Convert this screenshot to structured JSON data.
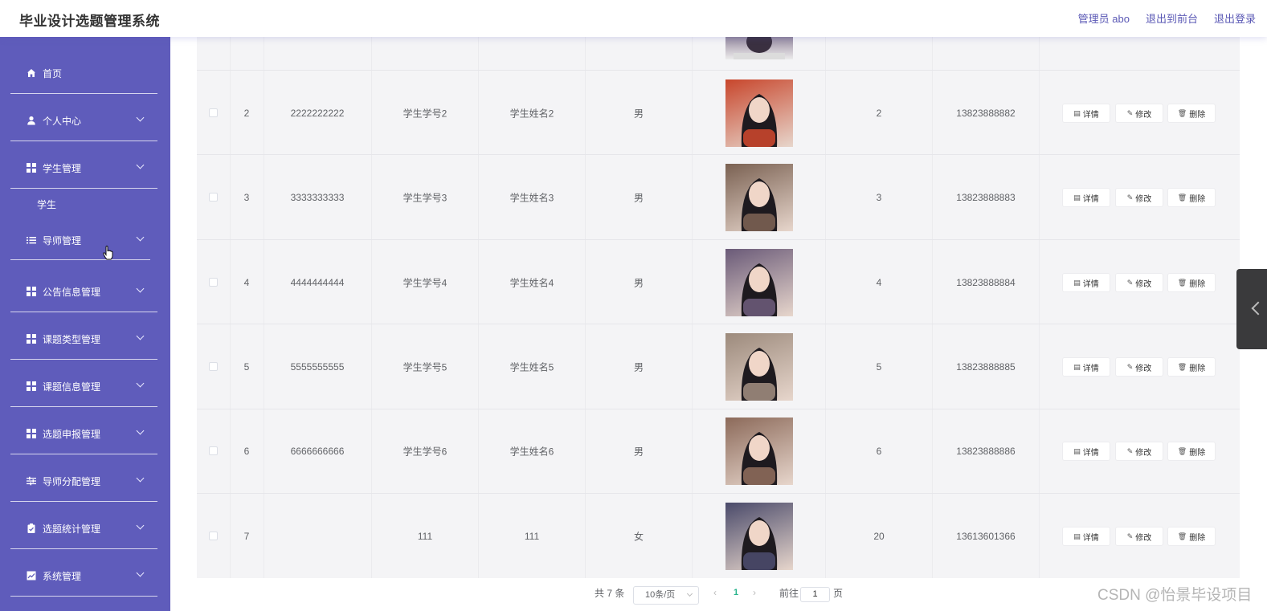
{
  "app": {
    "title": "毕业设计选题管理系统"
  },
  "header": {
    "admin_label": "管理员 abo",
    "back_front": "退出到前台",
    "logout": "退出登录"
  },
  "sidebar": {
    "items": [
      {
        "label": "首页",
        "icon": "home-icon"
      },
      {
        "label": "个人中心",
        "icon": "user-icon"
      },
      {
        "label": "学生管理",
        "icon": "grid-icon"
      },
      {
        "label": "导师管理",
        "icon": "list-icon"
      },
      {
        "label": "公告信息管理",
        "icon": "grid-icon"
      },
      {
        "label": "课题类型管理",
        "icon": "grid-icon"
      },
      {
        "label": "课题信息管理",
        "icon": "grid-icon"
      },
      {
        "label": "选题申报管理",
        "icon": "grid-icon"
      },
      {
        "label": "导师分配管理",
        "icon": "sliders-icon"
      },
      {
        "label": "选题统计管理",
        "icon": "clipboard-icon"
      },
      {
        "label": "系统管理",
        "icon": "chart-icon"
      }
    ],
    "sub_student": "学生"
  },
  "table": {
    "rows": [
      {
        "index": "2",
        "account": "2222222222",
        "student_no": "学生学号2",
        "name": "学生姓名2",
        "gender": "男",
        "photo_tone": "#c8462c",
        "class_no": "2",
        "phone": "13823888882"
      },
      {
        "index": "3",
        "account": "3333333333",
        "student_no": "学生学号3",
        "name": "学生姓名3",
        "gender": "男",
        "photo_tone": "#7a6152",
        "class_no": "3",
        "phone": "13823888883"
      },
      {
        "index": "4",
        "account": "4444444444",
        "student_no": "学生学号4",
        "name": "学生姓名4",
        "gender": "男",
        "photo_tone": "#6a5a78",
        "class_no": "4",
        "phone": "13823888884"
      },
      {
        "index": "5",
        "account": "5555555555",
        "student_no": "学生学号5",
        "name": "学生姓名5",
        "gender": "男",
        "photo_tone": "#9c8a7c",
        "class_no": "5",
        "phone": "13823888885"
      },
      {
        "index": "6",
        "account": "6666666666",
        "student_no": "学生学号6",
        "name": "学生姓名6",
        "gender": "男",
        "photo_tone": "#8c6a5a",
        "class_no": "6",
        "phone": "13823888886"
      },
      {
        "index": "7",
        "account": "",
        "student_no": "111",
        "name": "111",
        "gender": "女",
        "photo_tone": "#4a4a6a",
        "class_no": "20",
        "phone": "13613601366"
      }
    ],
    "actions": {
      "detail": "详情",
      "edit": "修改",
      "delete": "删除"
    }
  },
  "pager": {
    "total": "共 7 条",
    "page_size": "10条/页",
    "current": "1",
    "goto_prefix": "前往",
    "goto_value": "1",
    "goto_suffix": "页"
  },
  "watermark": "CSDN @怡景毕设项目",
  "colors": {
    "sidebar": "#5f5cbb",
    "accent": "#5a58b5",
    "pager_active": "#28b48c"
  }
}
